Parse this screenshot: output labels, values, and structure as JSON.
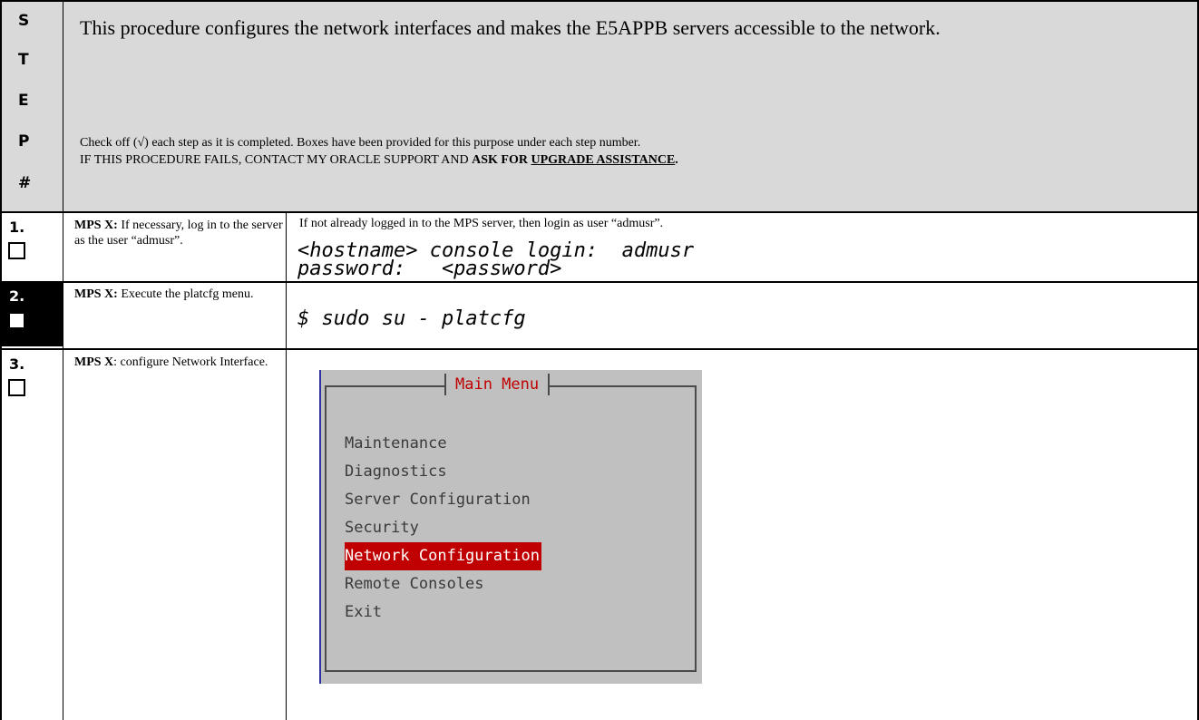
{
  "header": {
    "step_label_letters": [
      "S",
      "T",
      "E",
      "P",
      "#"
    ],
    "intro": "This procedure configures the network interfaces and makes the E5APPB servers accessible to the network.",
    "check_note": "Check off (√) each step as it is completed. Boxes have been provided for this purpose under each step number.",
    "fail_note_prefix": "IF THIS PROCEDURE FAILS, CONTACT MY ORACLE SUPPORT AND ",
    "fail_note_bold": "ASK FOR ",
    "fail_note_underline": "UPGRADE ASSISTANCE",
    "fail_note_end": "."
  },
  "steps": [
    {
      "number": "1.",
      "desc_bold": "MPS X:",
      "desc_text": " If necessary, log in to the server as the user “admusr”.",
      "content_text": "If not already logged in to the MPS server, then login as user “admusr”.",
      "cmd_line1": "<hostname> console login:  admusr",
      "cmd_line2": "password:   <password>"
    },
    {
      "number": "2.",
      "desc_bold": "MPS X:",
      "desc_text": " Execute the platcfg menu.",
      "cmd": "$ sudo su - platcfg"
    },
    {
      "number": "3.",
      "desc_bold": "MPS X",
      "desc_text": ": configure Network Interface.",
      "terminal": {
        "title": "Main Menu",
        "items": [
          "Maintenance",
          "Diagnostics",
          "Server Configuration",
          "Security",
          "Network Configuration",
          "Remote Consoles",
          "Exit"
        ],
        "selected": "Network Configuration"
      }
    }
  ]
}
